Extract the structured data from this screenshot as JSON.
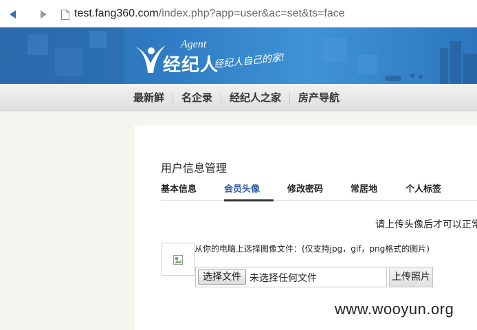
{
  "browser": {
    "url_host": "test.fang360.com",
    "url_path": "/index.php?app=user&ac=set&ts=face"
  },
  "banner": {
    "logo_agent": "Agent",
    "logo_title": "经纪人",
    "logo_slogan": "经纪人自己的家!"
  },
  "site_nav": {
    "items": [
      "最新鲜",
      "名企录",
      "经纪人之家",
      "房产导航"
    ]
  },
  "panel": {
    "title": "用户信息管理",
    "tabs": [
      {
        "label": "基本信息",
        "active": false
      },
      {
        "label": "会员头像",
        "active": true
      },
      {
        "label": "修改密码",
        "active": false
      },
      {
        "label": "常居地",
        "active": false
      },
      {
        "label": "个人标签",
        "active": false
      }
    ],
    "notice": "请上传头像后才可以正常",
    "upload_hint": "从你的电脑上选择图像文件：(仅支持jpg，gif，png格式的图片)",
    "choose_file_label": "选择文件",
    "no_file_text": "未选择任何文件",
    "upload_button": "上传照片"
  },
  "watermark": "www.wooyun.org",
  "colors": {
    "banner_blue": "#2f7cc4",
    "active_tab": "#2d5aa8"
  }
}
